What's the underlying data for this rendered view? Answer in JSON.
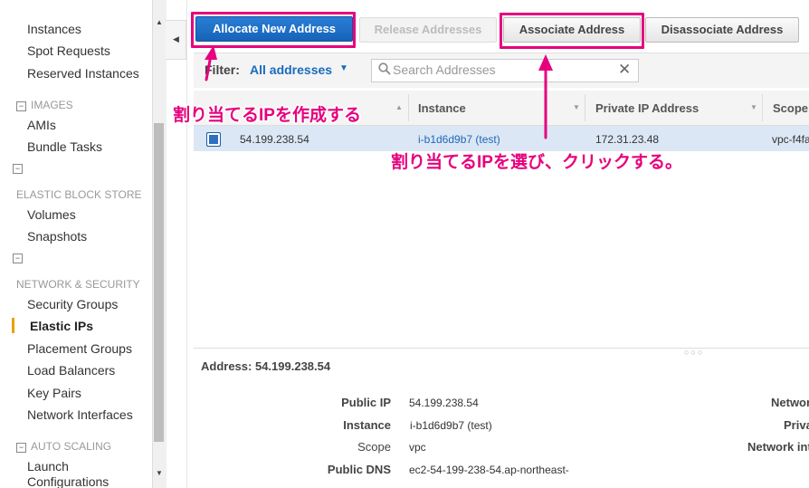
{
  "sidebar": {
    "items_top": [
      "Instances",
      "Spot Requests",
      "Reserved Instances"
    ],
    "images_header": "IMAGES",
    "images_items": [
      "AMIs",
      "Bundle Tasks"
    ],
    "ebs_header": "ELASTIC BLOCK STORE",
    "ebs_items": [
      "Volumes",
      "Snapshots"
    ],
    "network_header": "NETWORK & SECURITY",
    "network_items": [
      "Security Groups",
      "Elastic IPs",
      "Placement Groups",
      "Load Balancers",
      "Key Pairs",
      "Network Interfaces"
    ],
    "autoscaling_header": "AUTO SCALING",
    "autoscaling_items": [
      "Launch Configurations"
    ],
    "collapse_glyph": "−",
    "active_item": "Elastic IPs"
  },
  "toolbar": {
    "allocate_label": "Allocate New Address",
    "release_label": "Release Addresses",
    "associate_label": "Associate Address",
    "disassociate_label": "Disassociate Address"
  },
  "filter": {
    "label": "Filter:",
    "value": "All addresses",
    "search_placeholder": "Search Addresses",
    "clear_glyph": "✕"
  },
  "table": {
    "columns": [
      "Instance",
      "Private IP Address",
      "Scope"
    ],
    "rows": [
      {
        "address": "54.199.238.54",
        "instance": "i-b1d6d9b7 (test)",
        "private_ip": "172.31.23.48",
        "scope": "vpc-f4fa"
      }
    ]
  },
  "details": {
    "title": "Address: 54.199.238.54",
    "fields": [
      {
        "label": "Public IP",
        "value": "54.199.238.54"
      },
      {
        "label": "Instance",
        "value": "i-b1d6d9b7 (test)"
      },
      {
        "label": "Scope",
        "value": "vpc"
      },
      {
        "label": "Public DNS",
        "value": "ec2-54-199-238-54.ap-northeast-"
      }
    ],
    "right_labels": [
      "Networ",
      "Priva",
      "Network int"
    ]
  },
  "annotations": {
    "allocate_note": "割り当てるIPを作成する",
    "associate_note": "割り当てるIPを選び、クリックする。"
  },
  "colors": {
    "accent_pink": "#e6007e",
    "primary_blue": "#1a6bbd",
    "selected_row": "#dbe7f4",
    "active_marker": "#e8a200"
  }
}
